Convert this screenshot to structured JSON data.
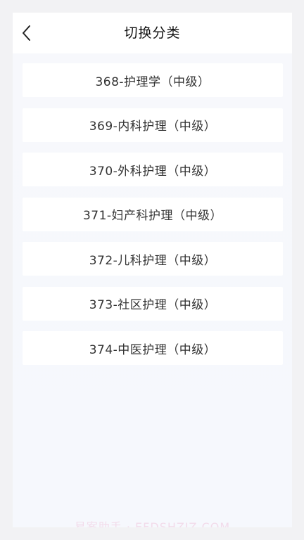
{
  "header": {
    "title": "切换分类",
    "back_icon": "chevron-left-icon"
  },
  "categories": [
    {
      "label": "368-护理学（中级）"
    },
    {
      "label": "369-内科护理（中级）"
    },
    {
      "label": "370-外科护理（中级）"
    },
    {
      "label": "371-妇产科护理（中级）"
    },
    {
      "label": "372-儿科护理（中级）"
    },
    {
      "label": "373-社区护理（中级）"
    },
    {
      "label": "374-中医护理（中级）"
    }
  ],
  "watermark": "易案助手 · EFDSHZIZ.COM",
  "colors": {
    "background": "#f6f8fd",
    "card": "#ffffff",
    "text": "#333333",
    "title": "#111111"
  }
}
